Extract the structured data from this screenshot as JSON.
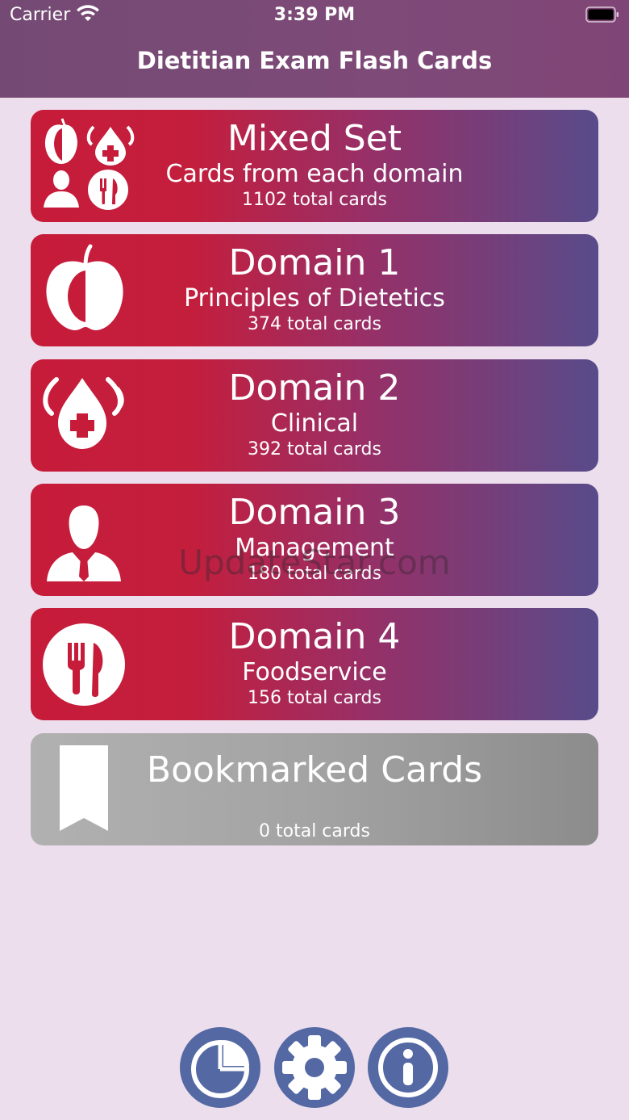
{
  "status_bar": {
    "carrier": "Carrier",
    "time": "3:39 PM"
  },
  "nav": {
    "title": "Dietitian Exam Flash Cards"
  },
  "cards": [
    {
      "title": "Mixed Set",
      "subtitle": "Cards from each domain",
      "count": "1102 total cards",
      "icon": "mixed-domains-icon"
    },
    {
      "title": "Domain 1",
      "subtitle": "Principles of Dietetics",
      "count": "374 total cards",
      "icon": "apple-icon"
    },
    {
      "title": "Domain 2",
      "subtitle": "Clinical",
      "count": "392 total cards",
      "icon": "medical-drop-icon"
    },
    {
      "title": "Domain 3",
      "subtitle": "Management",
      "count": "180 total cards",
      "icon": "manager-person-icon"
    },
    {
      "title": "Domain 4",
      "subtitle": "Foodservice",
      "count": "156 total cards",
      "icon": "fork-knife-icon"
    },
    {
      "title": "Bookmarked Cards",
      "subtitle": "",
      "count": "0 total cards",
      "icon": "bookmark-icon"
    }
  ],
  "watermark": "UpdateStar.com",
  "toolbar": {
    "stats_icon": "pie-chart-icon",
    "settings_icon": "gear-icon",
    "info_icon": "info-icon"
  },
  "colors": {
    "background": "#ecdeec",
    "header": "#7a4a77",
    "card_start": "#c61c3a",
    "card_end": "#584b8a",
    "bookmark_card": "#a3a3a3",
    "toolbar_button": "#5468a4"
  }
}
